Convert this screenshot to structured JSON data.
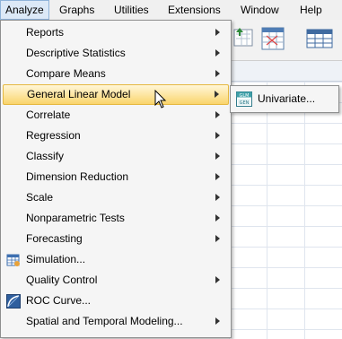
{
  "menubar": {
    "items": [
      {
        "label": "Analyze",
        "state": "open"
      },
      {
        "label": "Graphs"
      },
      {
        "label": "Utilities"
      },
      {
        "label": "Extensions"
      },
      {
        "label": "Window"
      },
      {
        "label": "Help"
      }
    ]
  },
  "analyze_menu": {
    "items": [
      {
        "label": "Reports",
        "submenu": true
      },
      {
        "label": "Descriptive Statistics",
        "submenu": true
      },
      {
        "label": "Compare Means",
        "submenu": true
      },
      {
        "label": "General Linear Model",
        "submenu": true,
        "state": "highlighted"
      },
      {
        "label": "Correlate",
        "submenu": true
      },
      {
        "label": "Regression",
        "submenu": true
      },
      {
        "label": "Classify",
        "submenu": true
      },
      {
        "label": "Dimension Reduction",
        "submenu": true
      },
      {
        "label": "Scale",
        "submenu": true
      },
      {
        "label": "Nonparametric Tests",
        "submenu": true
      },
      {
        "label": "Forecasting",
        "submenu": true
      },
      {
        "label": "Simulation...",
        "icon": "simulation-icon"
      },
      {
        "label": "Quality Control",
        "submenu": true
      },
      {
        "label": "ROC Curve...",
        "icon": "roc-curve-icon"
      },
      {
        "label": "Spatial and Temporal Modeling...",
        "submenu": true
      }
    ]
  },
  "glm_submenu": {
    "items": [
      {
        "label": "Univariate...",
        "icon": "univariate-icon"
      }
    ]
  },
  "colors": {
    "highlight_top": "#fff6d8",
    "highlight_bottom": "#f9d46c",
    "menu_bg": "#f5f5f5",
    "active_menu_bg": "#dce9f7"
  }
}
